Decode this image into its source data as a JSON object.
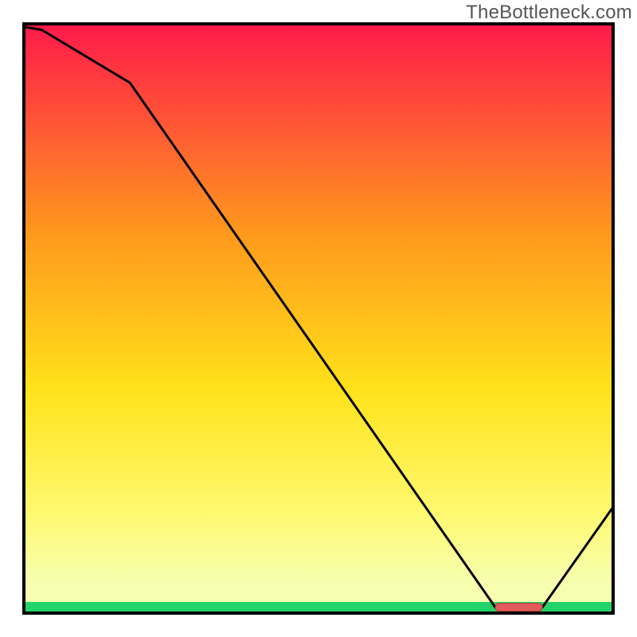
{
  "watermark": "TheBottleneck.com",
  "colors": {
    "top": "#ff1a4b",
    "mid_upper": "#ff9a1c",
    "mid": "#ffe21a",
    "mid_lower": "#fff970",
    "pale": "#f6ffb0",
    "green": "#22d36a",
    "line": "#000000",
    "marker": "#e25a5a",
    "marker_stroke": "#b93a3a"
  },
  "chart_data": {
    "type": "line",
    "title": "",
    "xlabel": "",
    "ylabel": "",
    "xlim": [
      0,
      100
    ],
    "ylim": [
      0,
      100
    ],
    "x": [
      0,
      3,
      18,
      80,
      88,
      100
    ],
    "y": [
      99.5,
      99,
      90,
      1,
      1,
      18
    ],
    "marker": {
      "x_start": 80,
      "x_end": 88,
      "y": 1
    },
    "notes": "V-shaped bottleneck curve. Values estimated from pixel positions; no axis ticks visible."
  }
}
